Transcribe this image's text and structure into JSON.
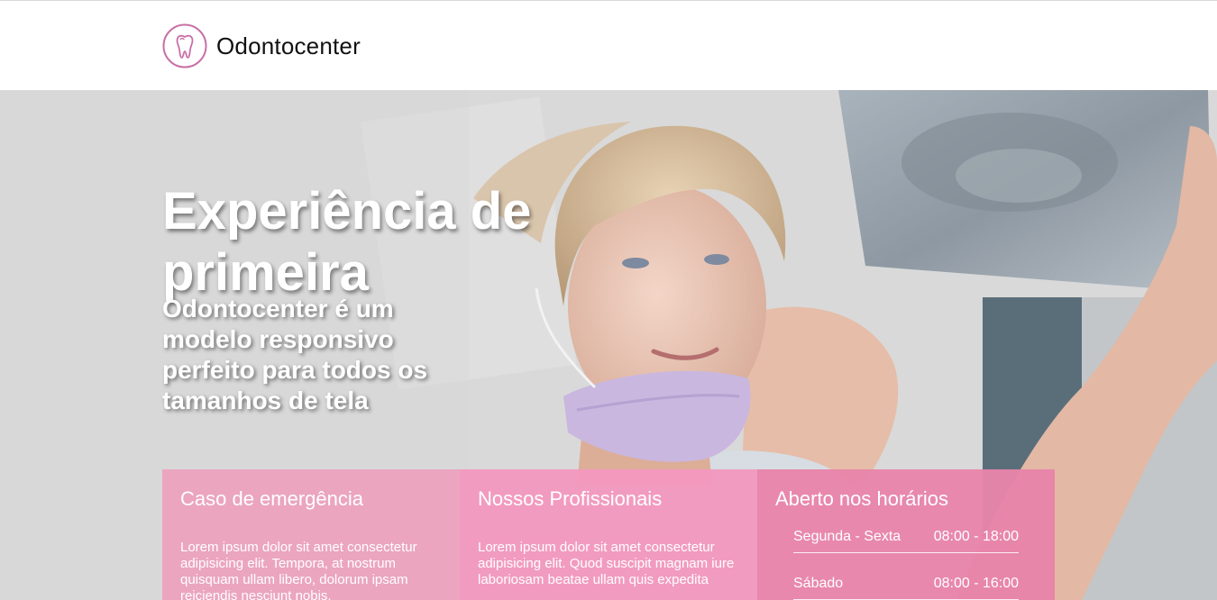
{
  "brand": {
    "name": "Odontocenter",
    "logo_icon": "tooth-icon",
    "accent": "#c86fa6"
  },
  "hero": {
    "title": "Experiência de primeira",
    "subtitle": "Odontocenter é um modelo responsivo perfeito para todos os tamanhos de tela"
  },
  "cards": [
    {
      "title": "Caso de emergência",
      "text": "Lorem ipsum dolor sit amet consectetur adipisicing elit. Tempora, at nostrum quisquam ullam libero, dolorum ipsam reiciendis nesciunt nobis."
    },
    {
      "title": "Nossos Profissionais",
      "text": "Lorem ipsum dolor sit amet consectetur adipisicing elit. Quod suscipit magnam iure laboriosam beatae ullam quis expedita"
    },
    {
      "title": "Aberto nos horários",
      "hours": [
        {
          "day": "Segunda - Sexta",
          "time": "08:00 - 18:00"
        },
        {
          "day": "Sábado",
          "time": "08:00 - 16:00"
        }
      ]
    }
  ],
  "colors": {
    "card_1": "#eca0bc",
    "card_2": "#f298be",
    "card_3": "#e884aa"
  }
}
